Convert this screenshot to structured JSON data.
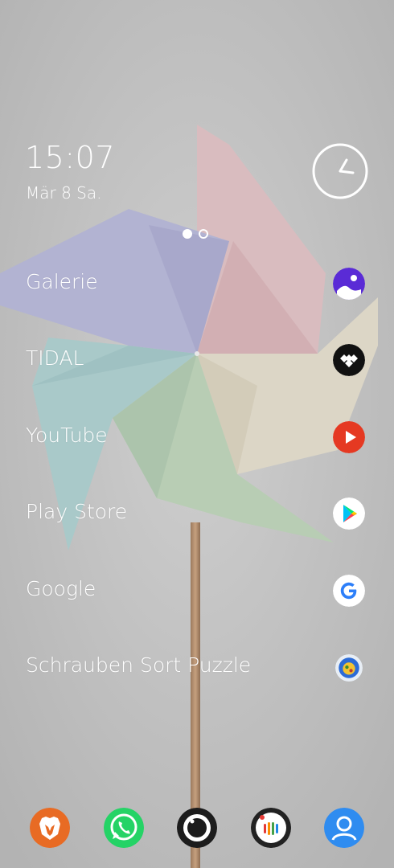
{
  "status": {
    "time": "15:07",
    "date": "Mär 8 Sa."
  },
  "pages": {
    "count": 2,
    "current": 1
  },
  "apps": [
    {
      "label": "Galerie",
      "icon": "gallery-icon"
    },
    {
      "label": "TIDAL",
      "icon": "tidal-icon"
    },
    {
      "label": "YouTube",
      "icon": "youtube-icon"
    },
    {
      "label": "Play Store",
      "icon": "play-store-icon"
    },
    {
      "label": "Google",
      "icon": "google-icon"
    },
    {
      "label": "Schrauben Sort Puzzle",
      "icon": "puzzle-game-icon"
    }
  ],
  "dock": [
    {
      "name": "brave-browser",
      "icon": "lion-icon",
      "color": "#e86b24"
    },
    {
      "name": "whatsapp",
      "icon": "phone-icon",
      "color": "#25d366"
    },
    {
      "name": "camera",
      "icon": "camera-icon",
      "color": "#1c1c1c"
    },
    {
      "name": "podcast",
      "icon": "bars-icon",
      "color": "#222222"
    },
    {
      "name": "contacts",
      "icon": "person-icon",
      "color": "#2f8cf0"
    }
  ]
}
